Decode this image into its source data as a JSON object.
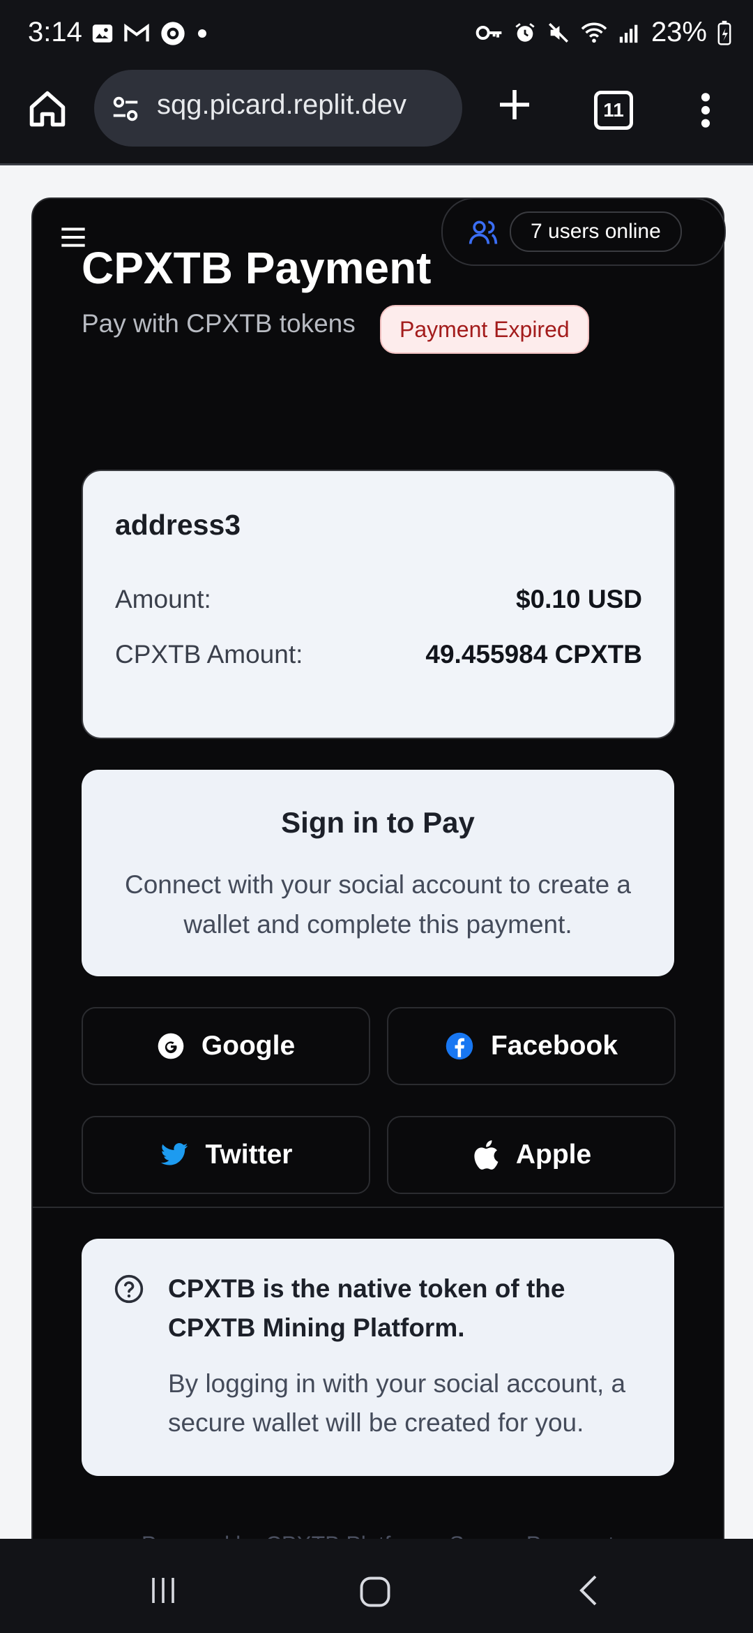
{
  "status_bar": {
    "time": "3:14",
    "battery": "23%"
  },
  "browser": {
    "url": "sqg.picard.replit.dev",
    "tab_count": "11"
  },
  "header": {
    "online_badge": "7 users online",
    "title": "CPXTB Payment",
    "subtitle": "Pay with CPXTB tokens",
    "status_badge": "Payment Expired"
  },
  "payment": {
    "address": "address3",
    "amount_label": "Amount:",
    "amount_value": "$0.10 USD",
    "cpxtb_label": "CPXTB Amount:",
    "cpxtb_value": "49.455984 CPXTB"
  },
  "signin": {
    "title": "Sign in to Pay",
    "description": "Connect with your social account to create a wallet and complete this payment."
  },
  "social_buttons": [
    {
      "label": "Google",
      "icon": "google-icon"
    },
    {
      "label": "Facebook",
      "icon": "facebook-icon"
    },
    {
      "label": "Twitter",
      "icon": "twitter-icon"
    },
    {
      "label": "Apple",
      "icon": "apple-icon"
    }
  ],
  "faq": {
    "heading": "CPXTB is the native token of the CPXTB Mining Platform.",
    "body": "By logging in with your social account, a secure wallet will be created for you."
  },
  "footer": "Powered by CPXTB Platform • Secure Payment",
  "colors": {
    "card_bg": "#0a0a0c",
    "badge_red": "#a31c1c",
    "facebook_blue": "#1877f2",
    "twitter_blue": "#1d9bf0",
    "users_icon_blue": "#3b6ef5"
  }
}
